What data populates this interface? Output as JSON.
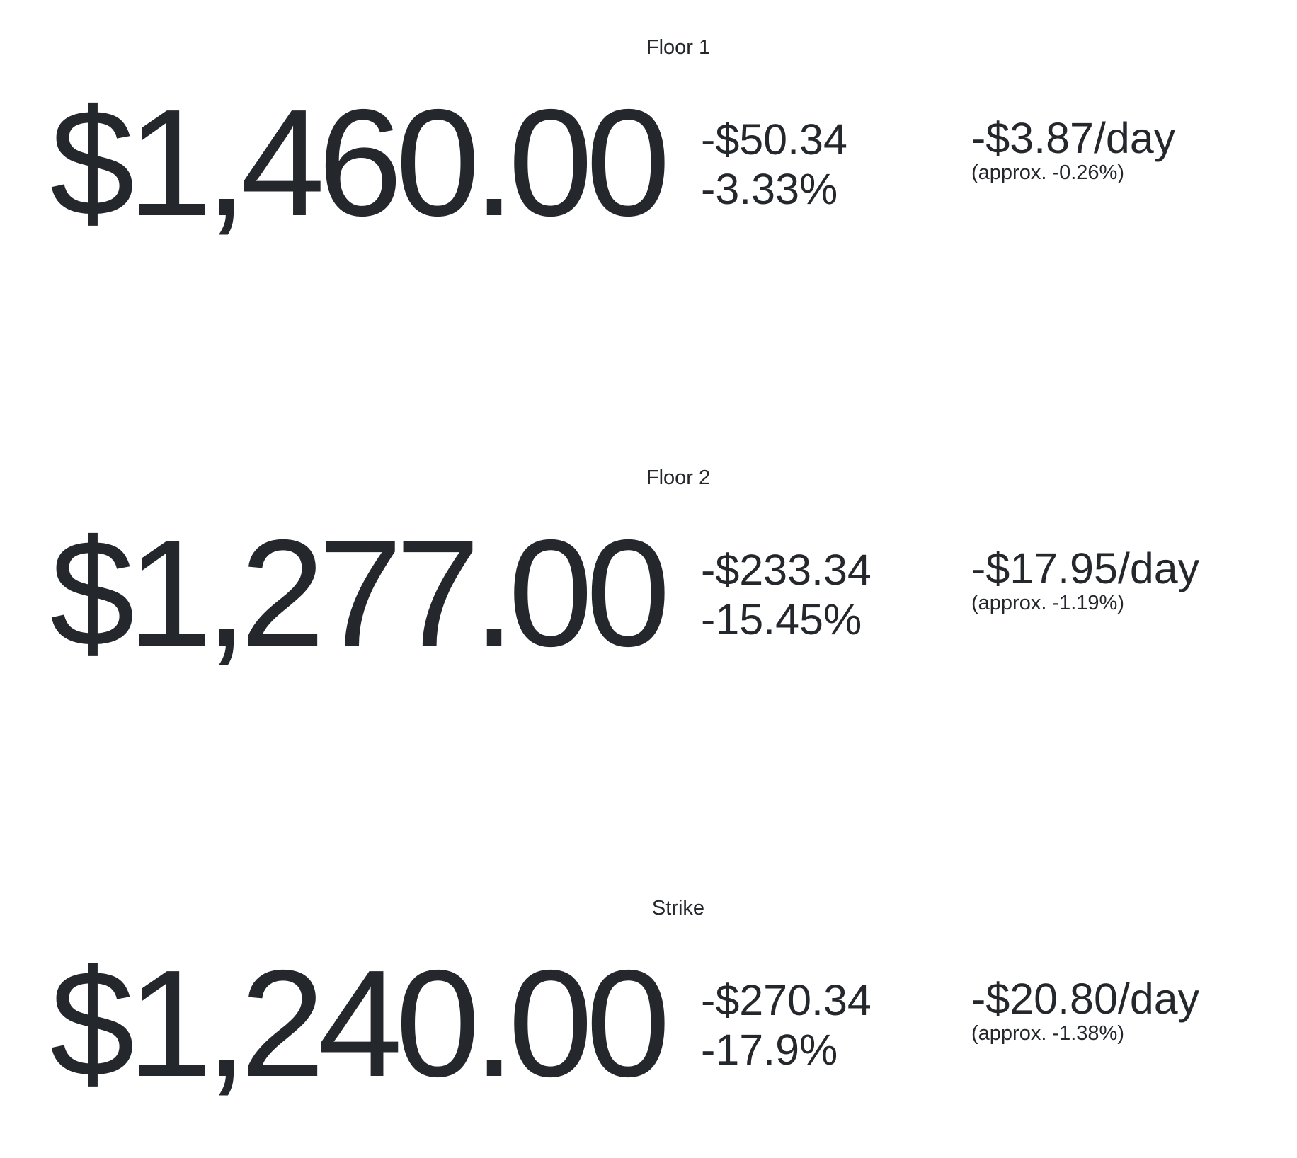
{
  "sections": [
    {
      "label": "Floor 1",
      "price": "$1,460.00",
      "change_amount": "-$50.34",
      "change_percent": "-3.33%",
      "rate": "-$3.87/day",
      "rate_approx": "(approx. -0.26%)"
    },
    {
      "label": "Floor 2",
      "price": "$1,277.00",
      "change_amount": "-$233.34",
      "change_percent": "-15.45%",
      "rate": "-$17.95/day",
      "rate_approx": "(approx. -1.19%)"
    },
    {
      "label": "Strike",
      "price": "$1,240.00",
      "change_amount": "-$270.34",
      "change_percent": "-17.9%",
      "rate": "-$20.80/day",
      "rate_approx": "(approx. -1.38%)"
    }
  ],
  "colors": {
    "text": "#24282d",
    "background": "#ffffff"
  }
}
